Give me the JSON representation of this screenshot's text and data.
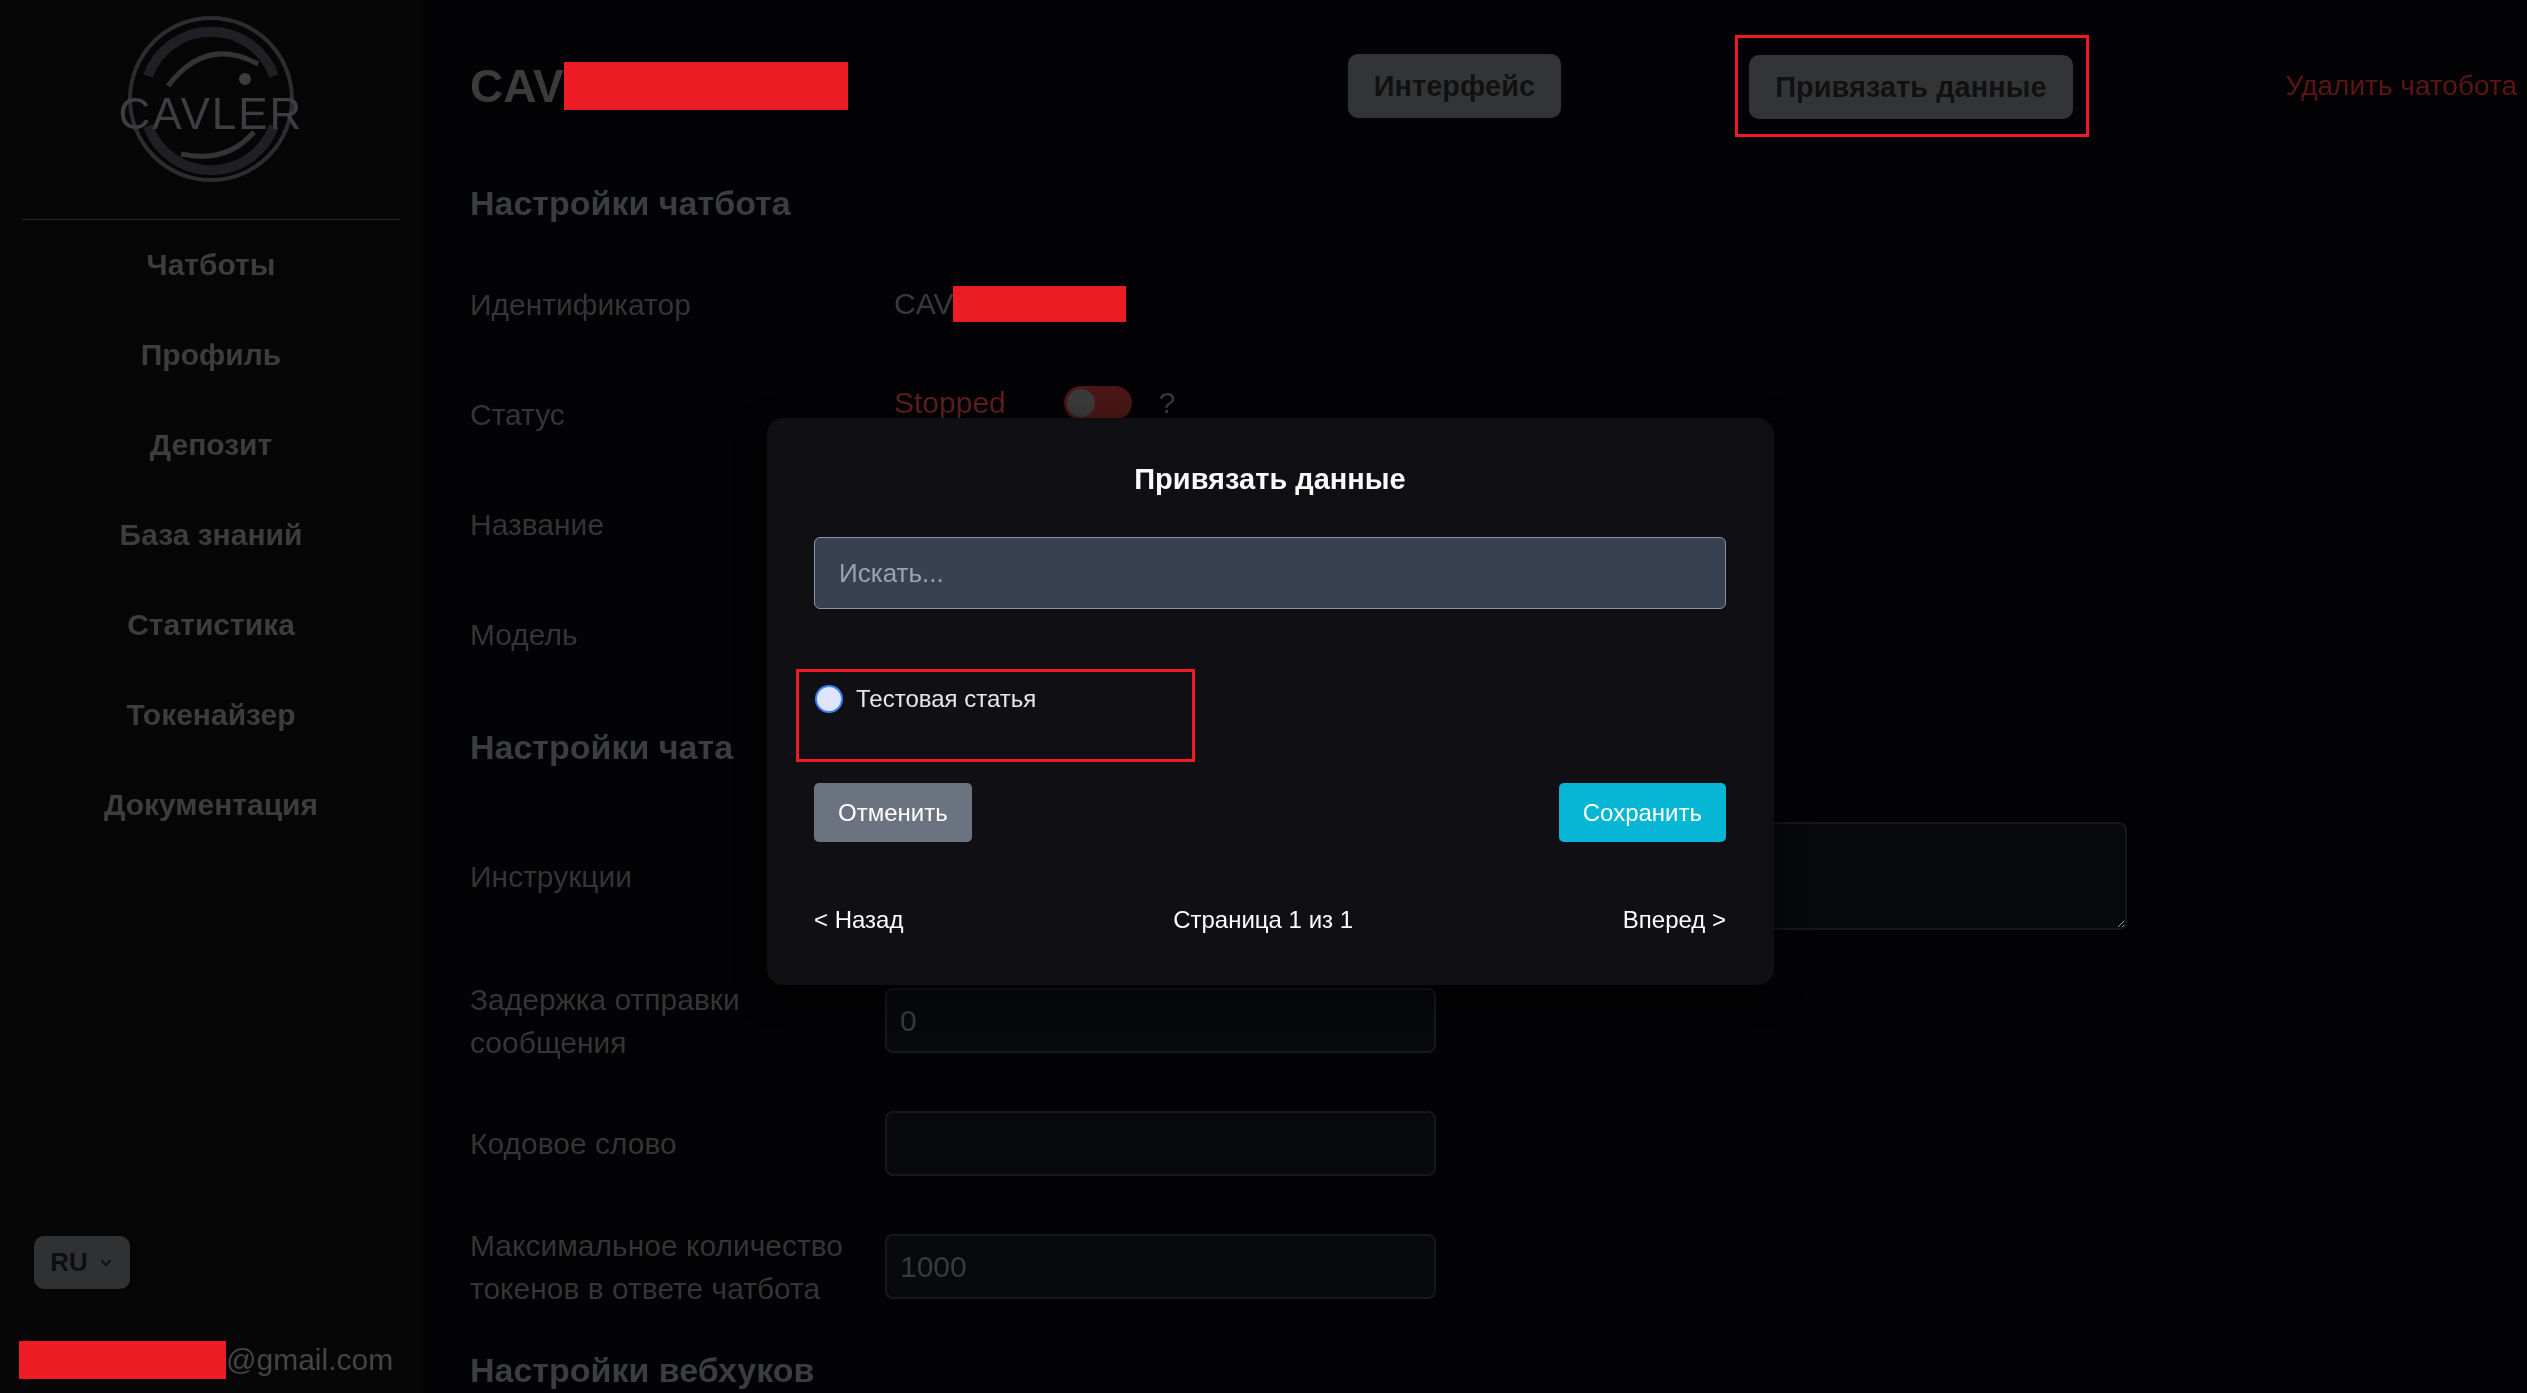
{
  "sidebar": {
    "logo": {
      "text": "CAVLER"
    },
    "nav": [
      {
        "label": "Чатботы"
      },
      {
        "label": "Профиль"
      },
      {
        "label": "Депозит"
      },
      {
        "label": "База знаний"
      },
      {
        "label": "Статистика"
      },
      {
        "label": "Токенайзер"
      },
      {
        "label": "Документация"
      }
    ],
    "language": {
      "value": "RU"
    },
    "user_email": {
      "text": "@gmail.com",
      "redacted": true
    }
  },
  "header": {
    "title": {
      "text": "CAV",
      "redacted": true
    },
    "buttons": [
      {
        "label": "Интерфейс",
        "kind": "button",
        "highlighted": false
      },
      {
        "label": "Привязать данные",
        "kind": "button",
        "highlighted": true
      },
      {
        "label": "Удалить чатобота",
        "kind": "link",
        "highlighted": false
      }
    ]
  },
  "sections": [
    {
      "title": "Настройки чатбота",
      "fields": [
        {
          "label": "Идентификатор",
          "kind": "text",
          "value": "CAV",
          "redacted": true
        },
        {
          "label": "Статус",
          "kind": "status",
          "value": "Stopped",
          "on": false,
          "help": "?"
        },
        {
          "label": "Название",
          "kind": "label"
        },
        {
          "label": "Модель",
          "kind": "label"
        }
      ]
    },
    {
      "title": "Настройки чата",
      "fields": [
        {
          "label": "Инструкции",
          "kind": "textarea"
        },
        {
          "label": "Задержка отправки сообщения",
          "kind": "input",
          "value": "0"
        },
        {
          "label": "Кодовое слово",
          "kind": "input"
        },
        {
          "label": "Максимальное количество токенов в ответе чатбота",
          "kind": "input",
          "value": "1000"
        }
      ]
    },
    {
      "title": "Настройки вебхуков"
    }
  ],
  "modal": {
    "title": "Привязать данные",
    "search": {
      "placeholder": "Искать..."
    },
    "items": [
      {
        "label": "Тестовая статья",
        "selected": false,
        "highlighted": true
      }
    ],
    "buttons": [
      {
        "label": "Отменить",
        "kind": "secondary"
      },
      {
        "label": "Сохранить",
        "kind": "primary"
      }
    ],
    "pagination": {
      "prev": "< Назад",
      "page": "Страница 1 из 1",
      "next": "Вперед >"
    }
  }
}
